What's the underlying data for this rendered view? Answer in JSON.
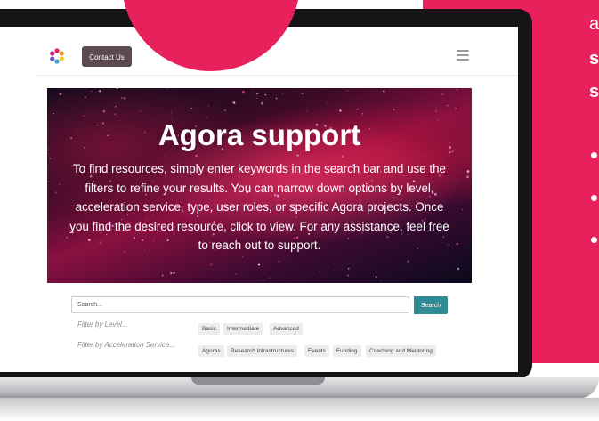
{
  "site": {
    "contact_label": "Contact Us",
    "menu_icon": "hamburger-menu-icon",
    "logo_icon": "flower-logo-icon"
  },
  "hero": {
    "title": "Agora support",
    "description": "To find resources, simply enter keywords in the search bar and use the filters to refine your results. You can narrow down options by level, acceleration service, type, user roles, or specific Agora projects. Once you find the desired resource, click to view. For any assistance, feel free to reach out to support."
  },
  "search": {
    "placeholder": "Search...",
    "button_label": "Search"
  },
  "filters": {
    "level": {
      "placeholder": "Filter by Level...",
      "options": [
        "Basic",
        "Intermediate",
        "Advanced"
      ]
    },
    "acceleration": {
      "placeholder": "Filter by Acceleration Service...",
      "options": [
        "Agoras",
        "Research Infrastructures",
        "Events",
        "Funding",
        "Coaching and Mentoring"
      ]
    }
  },
  "side_panel": {
    "line1": "a",
    "line2": "s",
    "line3": "s",
    "bullet_count": 3
  },
  "colors": {
    "accent_pink": "#e8215c",
    "search_teal": "#2e8b93",
    "contact_button": "#5c4a4e"
  }
}
